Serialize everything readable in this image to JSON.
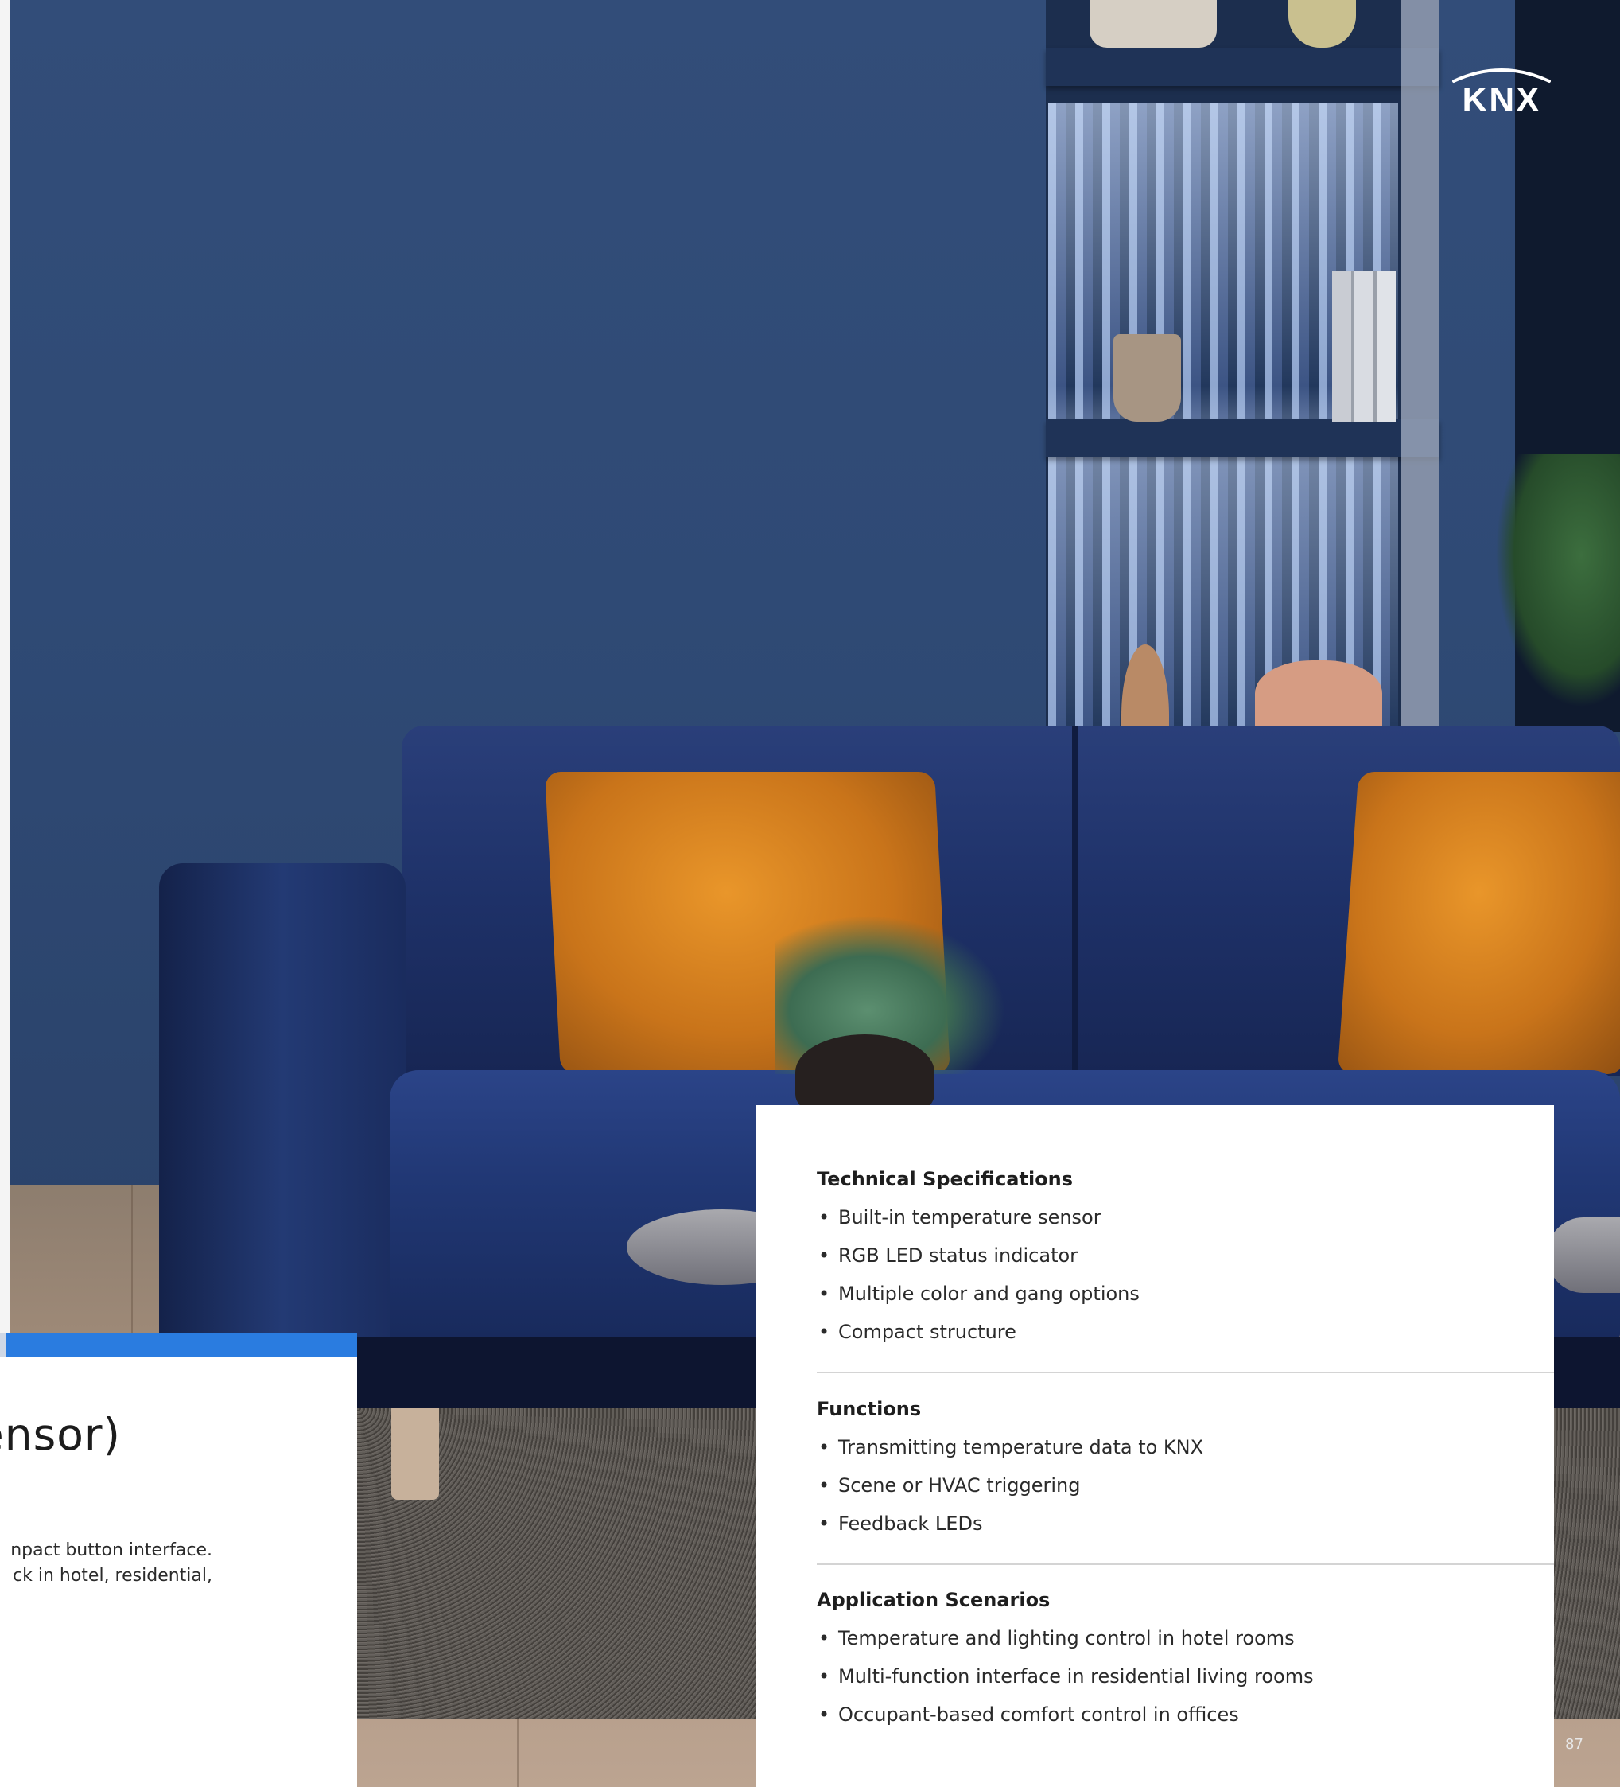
{
  "brand": {
    "logo_text": "KNX"
  },
  "intro": {
    "title_fragment": "ensor)",
    "body_lines": [
      "npact button interface.",
      "ck in hotel, residential,"
    ]
  },
  "spec_card": {
    "sections": [
      {
        "heading": "Technical Specifications",
        "items": [
          "Built-in temperature sensor",
          "RGB LED status indicator",
          "Multiple color and gang options",
          "Compact structure"
        ]
      },
      {
        "heading": "Functions",
        "items": [
          "Transmitting temperature data to KNX",
          "Scene or HVAC triggering",
          "Feedback LEDs"
        ]
      },
      {
        "heading": "Application Scenarios",
        "items": [
          "Temperature and lighting control in hotel rooms",
          "Multi-function interface in residential living rooms",
          "Occupant-based comfort control in offices"
        ]
      }
    ]
  },
  "page_number": "87",
  "colors": {
    "accent_bar": "#2a7ce0",
    "wall": "#2f4a75",
    "sofa": "#1e3168",
    "pillow": "#d9861f"
  }
}
